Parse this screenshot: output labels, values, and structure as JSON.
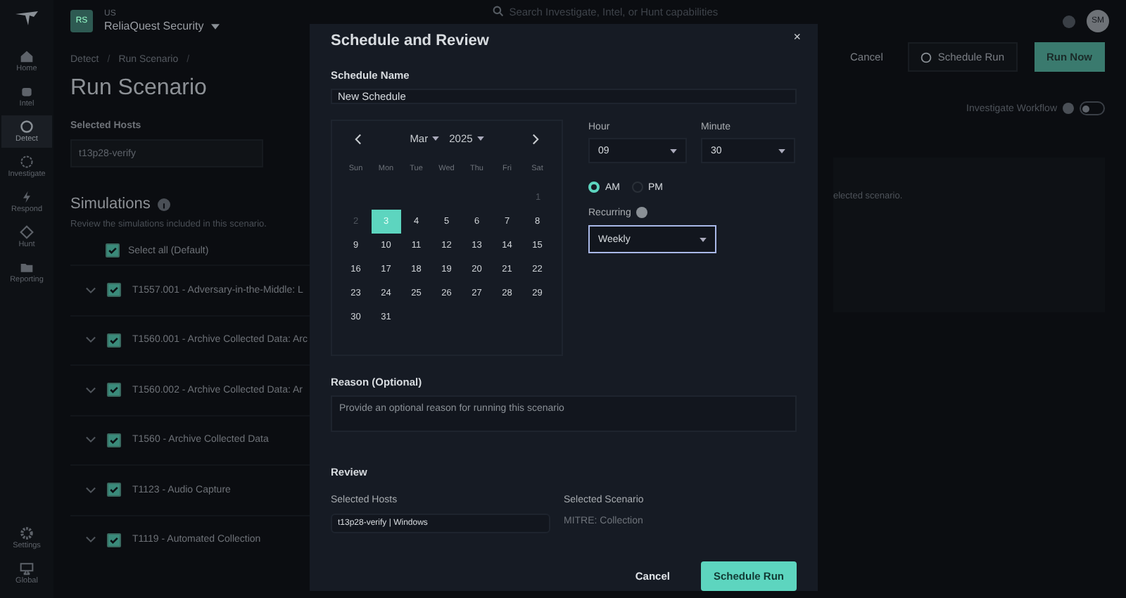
{
  "sidebar": {
    "items": [
      {
        "label": "Home",
        "kind": "home",
        "selected": false
      },
      {
        "label": "Intel",
        "kind": "intel",
        "selected": false
      },
      {
        "label": "Detect",
        "kind": "detect",
        "selected": true
      },
      {
        "label": "Investigate",
        "kind": "investigate",
        "selected": false
      },
      {
        "label": "Respond",
        "kind": "respond",
        "selected": false
      },
      {
        "label": "Hunt",
        "kind": "hunt",
        "selected": false
      },
      {
        "label": "Reporting",
        "kind": "reports",
        "selected": false
      }
    ],
    "bottom_items": [
      {
        "label": "Settings",
        "kind": "settings"
      },
      {
        "label": "Global",
        "kind": "global"
      }
    ]
  },
  "header": {
    "org_badge": "RS",
    "region": "US",
    "org_name": "ReliaQuest Security",
    "search": {
      "placeholder": "Search Investigate, Intel, or Hunt capabilities"
    },
    "avatar": "SM"
  },
  "page": {
    "breadcrumb": [
      {
        "kind": "link",
        "text": "Detect"
      },
      {
        "kind": "separator",
        "text": "/"
      },
      {
        "kind": "link",
        "text": "Run Scenario"
      },
      {
        "kind": "separator",
        "text": "/"
      }
    ],
    "title": "Run Scenario",
    "selected_hosts_label": "Selected Hosts",
    "host": "t13p28-verify",
    "simulations_title": "Simulations",
    "simulations_desc": "Review the simulations included in this scenario.",
    "select_all": {
      "label": "Select all (Default)",
      "checked": true
    },
    "simulations": [
      {
        "label": "T1557.001 - Adversary-in-the-Middle: L",
        "checked": true
      },
      {
        "label": "T1560.001 - Archive Collected Data: Arc",
        "checked": true
      },
      {
        "label": "T1560.002 - Archive Collected Data: Ar",
        "checked": true
      },
      {
        "label": "T1560 - Archive Collected Data",
        "checked": true
      },
      {
        "label": "T1123 - Audio Capture",
        "checked": true
      },
      {
        "label": "T1119 - Automated Collection",
        "checked": true
      }
    ],
    "actions": {
      "cancel": "Cancel",
      "schedule": "Schedule Run",
      "run": "Run Now"
    },
    "investigate_workflow": {
      "label": "Investigate Workflow",
      "on": false
    },
    "scenario_panel_text": "elected scenario."
  },
  "modal": {
    "title": "Schedule and Review",
    "close": "×",
    "schedule_name_label": "Schedule Name",
    "schedule_name": "New Schedule",
    "calendar": {
      "month": "Mar",
      "year": "2025",
      "weekdays": [
        "Sun",
        "Mon",
        "Tue",
        "Wed",
        "Thu",
        "Fri",
        "Sat"
      ],
      "weeks": [
        {
          "days": [
            {
              "label": "1",
              "selected": false,
              "disabled": true
            }
          ]
        },
        {
          "days": [
            {
              "label": "2",
              "selected": false,
              "disabled": true
            },
            {
              "label": "3",
              "selected": true,
              "disabled": false
            },
            {
              "label": "4",
              "selected": false,
              "disabled": false
            },
            {
              "label": "5",
              "selected": false,
              "disabled": false
            },
            {
              "label": "6",
              "selected": false,
              "disabled": false
            },
            {
              "label": "7",
              "selected": false,
              "disabled": false
            },
            {
              "label": "8",
              "selected": false,
              "disabled": false
            }
          ]
        },
        {
          "days": [
            {
              "label": "9",
              "selected": false,
              "disabled": false
            },
            {
              "label": "10",
              "selected": false,
              "disabled": false
            },
            {
              "label": "11",
              "selected": false,
              "disabled": false
            },
            {
              "label": "12",
              "selected": false,
              "disabled": false
            },
            {
              "label": "13",
              "selected": false,
              "disabled": false
            },
            {
              "label": "14",
              "selected": false,
              "disabled": false
            },
            {
              "label": "15",
              "selected": false,
              "disabled": false
            }
          ]
        },
        {
          "days": [
            {
              "label": "16",
              "selected": false,
              "disabled": false
            },
            {
              "label": "17",
              "selected": false,
              "disabled": false
            },
            {
              "label": "18",
              "selected": false,
              "disabled": false
            },
            {
              "label": "19",
              "selected": false,
              "disabled": false
            },
            {
              "label": "20",
              "selected": false,
              "disabled": false
            },
            {
              "label": "21",
              "selected": false,
              "disabled": false
            },
            {
              "label": "22",
              "selected": false,
              "disabled": false
            }
          ]
        },
        {
          "days": [
            {
              "label": "23",
              "selected": false,
              "disabled": false
            },
            {
              "label": "24",
              "selected": false,
              "disabled": false
            },
            {
              "label": "25",
              "selected": false,
              "disabled": false
            },
            {
              "label": "26",
              "selected": false,
              "disabled": false
            },
            {
              "label": "27",
              "selected": false,
              "disabled": false
            },
            {
              "label": "28",
              "selected": false,
              "disabled": false
            },
            {
              "label": "29",
              "selected": false,
              "disabled": false
            }
          ]
        },
        {
          "days": [
            {
              "label": "30",
              "selected": false,
              "disabled": false
            },
            {
              "label": "31",
              "selected": false,
              "disabled": false
            }
          ]
        }
      ]
    },
    "hour": {
      "label": "Hour",
      "value": "09"
    },
    "minute": {
      "label": "Minute",
      "value": "30"
    },
    "meridiem": [
      {
        "label": "AM",
        "selected": true
      },
      {
        "label": "PM",
        "selected": false
      }
    ],
    "recurring": {
      "label": "Recurring",
      "value": "Weekly",
      "focused": true
    },
    "reason": {
      "label": "Reason (Optional)",
      "placeholder": "Provide an optional reason for running this scenario"
    },
    "review": {
      "title": "Review",
      "hosts_label": "Selected Hosts",
      "host_chip": "t13p28-verify | Windows",
      "scenario_label": "Selected Scenario",
      "scenario": "MITRE: Collection"
    },
    "buttons": {
      "cancel": "Cancel",
      "submit": "Schedule Run"
    }
  }
}
